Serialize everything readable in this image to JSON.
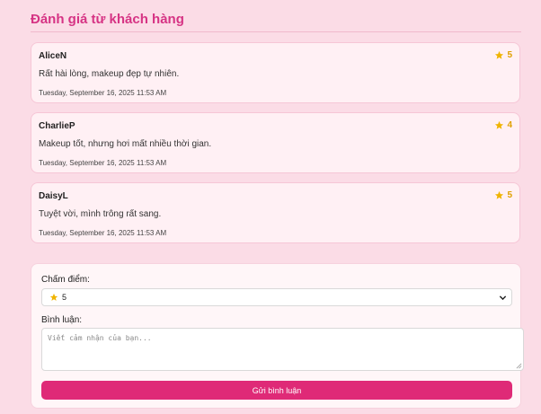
{
  "section": {
    "title": "Đánh giá từ khách hàng"
  },
  "reviews": [
    {
      "author": "AliceN",
      "rating": "5",
      "comment": "Rất hài lòng, makeup đẹp tự nhiên.",
      "timestamp": "Tuesday, September 16, 2025 11:53 AM"
    },
    {
      "author": "CharlieP",
      "rating": "4",
      "comment": "Makeup tốt, nhưng hơi mất nhiều thời gian.",
      "timestamp": "Tuesday, September 16, 2025 11:53 AM"
    },
    {
      "author": "DaisyL",
      "rating": "5",
      "comment": "Tuyệt vời, mình trông rất sang.",
      "timestamp": "Tuesday, September 16, 2025 11:53 AM"
    }
  ],
  "form": {
    "rating_label": "Chấm điểm:",
    "rating_selected": "5",
    "comment_label": "Bình luận:",
    "comment_placeholder": "Viết cảm nhận của bạn...",
    "comment_value": "",
    "submit_label": "Gửi bình luận"
  },
  "colors": {
    "page_background": "#fbdce6",
    "accent": "#d63384",
    "button": "#df2a77",
    "star": "#e0a100"
  },
  "icons": {
    "rating": "star-icon",
    "select": "chevron-down-icon",
    "textarea": "resize-handle-icon"
  }
}
